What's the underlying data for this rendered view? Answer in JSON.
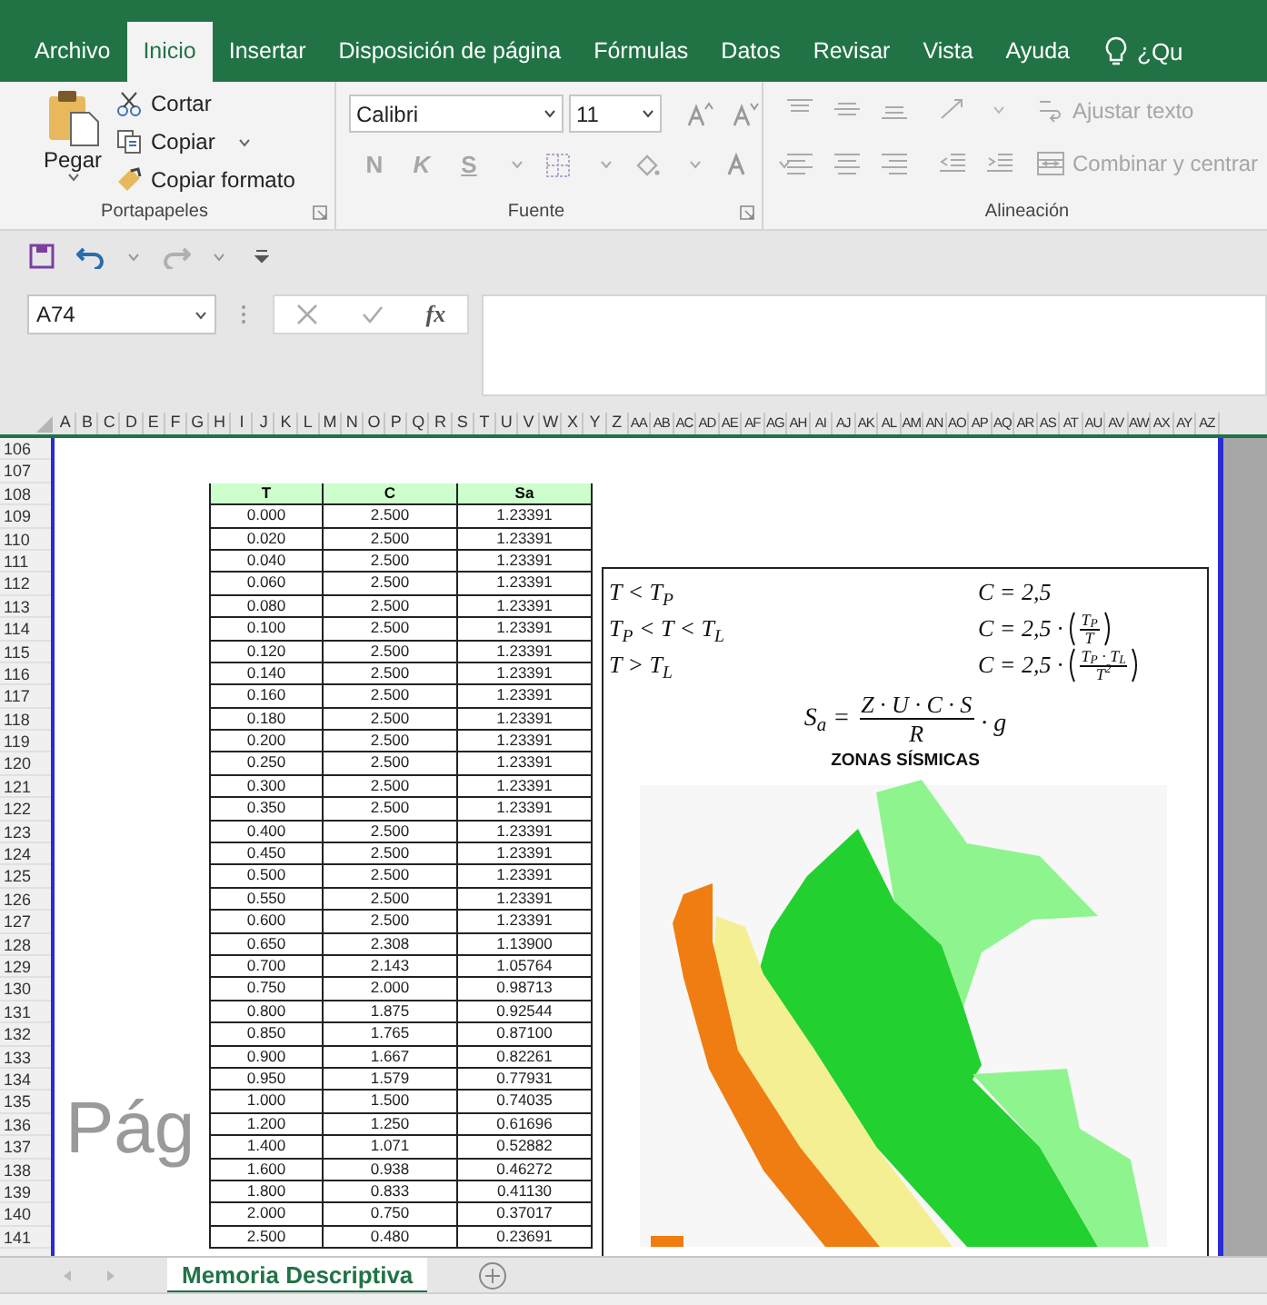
{
  "tabs": [
    {
      "label": "Archivo",
      "selected": false
    },
    {
      "label": "Inicio",
      "selected": true
    },
    {
      "label": "Insertar",
      "selected": false
    },
    {
      "label": "Disposición de página",
      "selected": false
    },
    {
      "label": "Fórmulas",
      "selected": false
    },
    {
      "label": "Datos",
      "selected": false
    },
    {
      "label": "Revisar",
      "selected": false
    },
    {
      "label": "Vista",
      "selected": false
    },
    {
      "label": "Ayuda",
      "selected": false
    }
  ],
  "tell_me": "¿Qu",
  "clipboard": {
    "paste": "Pegar",
    "cut": "Cortar",
    "copy": "Copiar",
    "format_painter": "Copiar formato",
    "group": "Portapapeles"
  },
  "font": {
    "name": "Calibri",
    "size": "11",
    "group": "Fuente",
    "style_buttons": [
      {
        "label": "N",
        "disabled": true
      },
      {
        "label": "K",
        "disabled": true
      },
      {
        "label": "S",
        "disabled": true
      }
    ]
  },
  "alignment": {
    "group": "Alineación",
    "wrap": {
      "label": "Ajustar texto",
      "disabled": true
    },
    "merge": {
      "label": "Combinar y centrar",
      "disabled": true
    }
  },
  "quick_access": [
    {
      "kind": "save"
    },
    {
      "kind": "undo",
      "disabled": false
    },
    {
      "kind": "redo",
      "disabled": true
    }
  ],
  "name_box": "A74",
  "function_button": "fx",
  "columns": [
    "A",
    "B",
    "C",
    "D",
    "E",
    "F",
    "G",
    "H",
    "I",
    "J",
    "K",
    "L",
    "M",
    "N",
    "O",
    "P",
    "Q",
    "R",
    "S",
    "T",
    "U",
    "V",
    "W",
    "X",
    "Y",
    "Z",
    "AA",
    "AB",
    "AC",
    "AD",
    "AE",
    "AF",
    "AG",
    "AH",
    "AI",
    "AJ",
    "AK",
    "AL",
    "AM",
    "AN",
    "AO",
    "AP",
    "AQ",
    "AR",
    "AS",
    "AT",
    "AU",
    "AV",
    "AW",
    "AX",
    "AY",
    "AZ"
  ],
  "row_numbers": [
    "106",
    "107",
    "108",
    "109",
    "110",
    "111",
    "112",
    "113",
    "114",
    "115",
    "116",
    "117",
    "118",
    "119",
    "120",
    "121",
    "122",
    "123",
    "124",
    "125",
    "126",
    "127",
    "128",
    "129",
    "130",
    "131",
    "132",
    "133",
    "134",
    "135",
    "136",
    "137",
    "138",
    "139",
    "140",
    "141"
  ],
  "table": {
    "columns": [
      "T",
      "C",
      "Sa"
    ],
    "rows": [
      [
        "0.000",
        "2.500",
        "1.23391"
      ],
      [
        "0.020",
        "2.500",
        "1.23391"
      ],
      [
        "0.040",
        "2.500",
        "1.23391"
      ],
      [
        "0.060",
        "2.500",
        "1.23391"
      ],
      [
        "0.080",
        "2.500",
        "1.23391"
      ],
      [
        "0.100",
        "2.500",
        "1.23391"
      ],
      [
        "0.120",
        "2.500",
        "1.23391"
      ],
      [
        "0.140",
        "2.500",
        "1.23391"
      ],
      [
        "0.160",
        "2.500",
        "1.23391"
      ],
      [
        "0.180",
        "2.500",
        "1.23391"
      ],
      [
        "0.200",
        "2.500",
        "1.23391"
      ],
      [
        "0.250",
        "2.500",
        "1.23391"
      ],
      [
        "0.300",
        "2.500",
        "1.23391"
      ],
      [
        "0.350",
        "2.500",
        "1.23391"
      ],
      [
        "0.400",
        "2.500",
        "1.23391"
      ],
      [
        "0.450",
        "2.500",
        "1.23391"
      ],
      [
        "0.500",
        "2.500",
        "1.23391"
      ],
      [
        "0.550",
        "2.500",
        "1.23391"
      ],
      [
        "0.600",
        "2.500",
        "1.23391"
      ],
      [
        "0.650",
        "2.308",
        "1.13900"
      ],
      [
        "0.700",
        "2.143",
        "1.05764"
      ],
      [
        "0.750",
        "2.000",
        "0.98713"
      ],
      [
        "0.800",
        "1.875",
        "0.92544"
      ],
      [
        "0.850",
        "1.765",
        "0.87100"
      ],
      [
        "0.900",
        "1.667",
        "0.82261"
      ],
      [
        "0.950",
        "1.579",
        "0.77931"
      ],
      [
        "1.000",
        "1.500",
        "0.74035"
      ],
      [
        "1.200",
        "1.250",
        "0.61696"
      ],
      [
        "1.400",
        "1.071",
        "0.52882"
      ],
      [
        "1.600",
        "0.938",
        "0.46272"
      ],
      [
        "1.800",
        "0.833",
        "0.41130"
      ],
      [
        "2.000",
        "0.750",
        "0.37017"
      ],
      [
        "2.500",
        "0.480",
        "0.23691"
      ]
    ]
  },
  "page_label": "Pág",
  "formula_image": {
    "cases": [
      {
        "condition": "T < T$_{P}$",
        "lhs": "C = 2,5"
      },
      {
        "condition": "T$_{P}$ < T < T$_{L}$",
        "lhs": "C = 2,5 ·",
        "numerator": "T$_{P}$",
        "denominator": "T"
      },
      {
        "condition": "T > T$_{L}$",
        "lhs": "C = 2,5 ·",
        "numerator": "T$_{P}$ · T$_{L}$",
        "denominator": "T$^{2}$"
      }
    ],
    "main": {
      "lhs": "S$_{a}$ =",
      "numerator": "Z · U · C · S",
      "denominator": "R",
      "tail": "· g"
    },
    "title": "ZONAS SÍSMICAS"
  },
  "sheet_tabs": [
    {
      "label": "Memoria Descriptiva",
      "selected": true
    }
  ]
}
